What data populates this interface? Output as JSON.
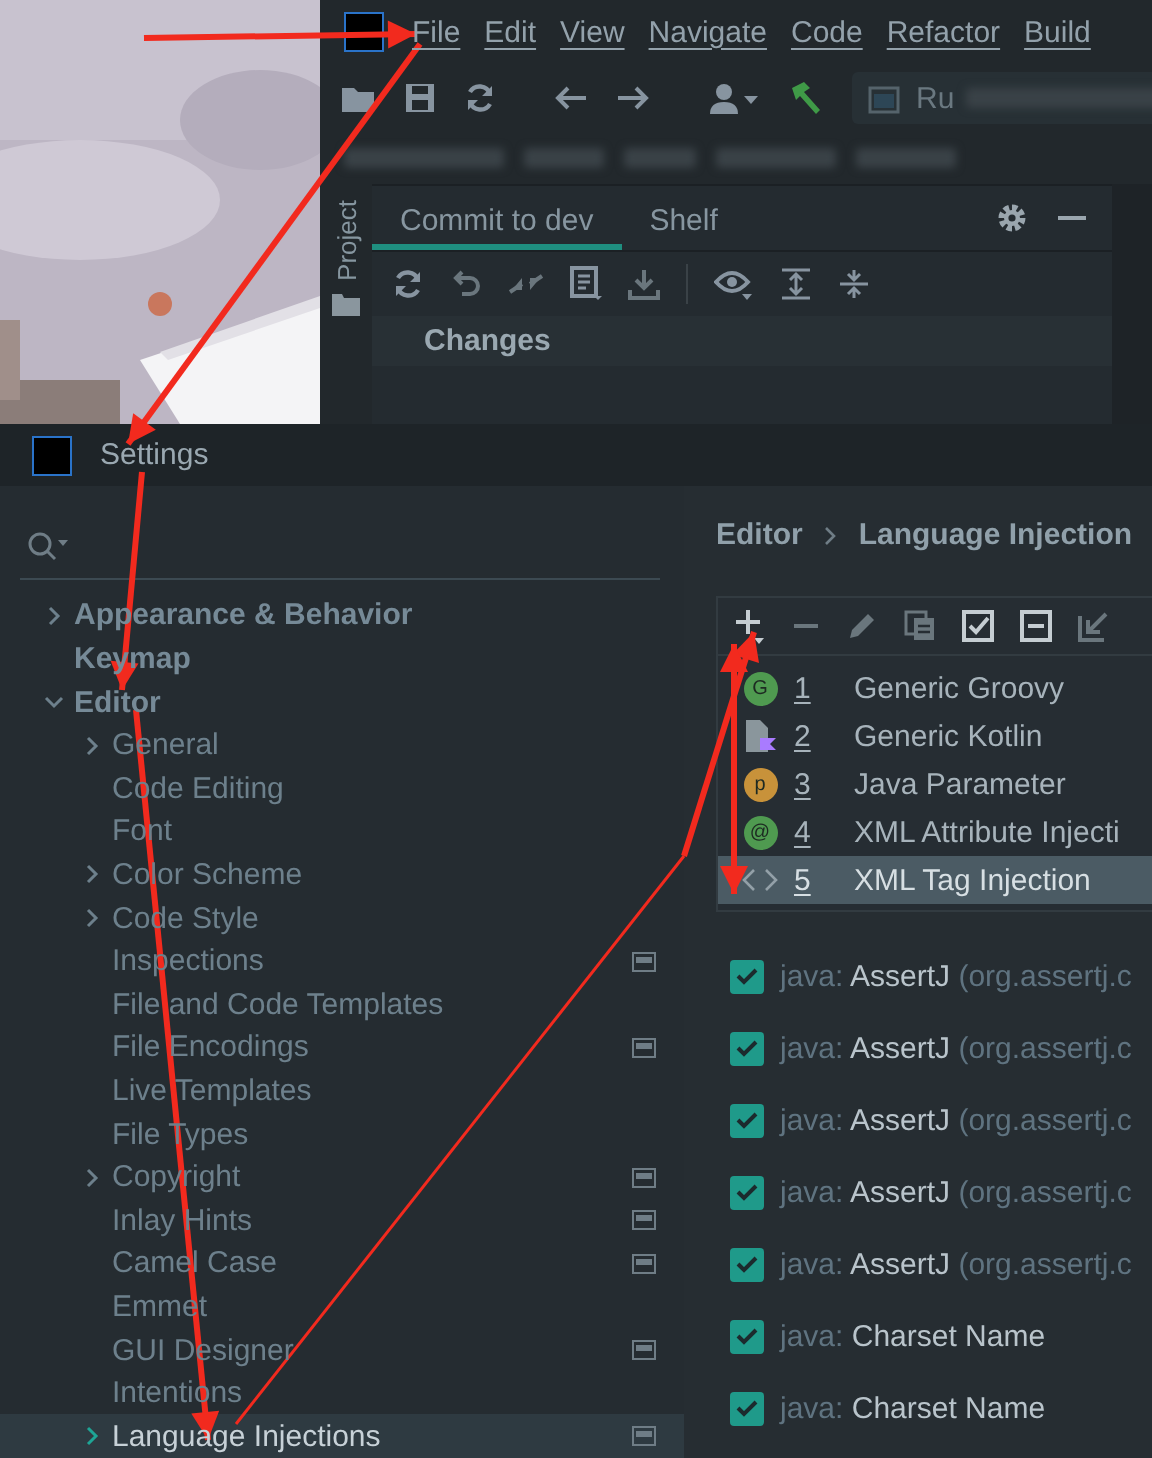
{
  "ide": {
    "menu": [
      "File",
      "Edit",
      "View",
      "Navigate",
      "Code",
      "Refactor",
      "Build"
    ],
    "run_config": "Ru",
    "side_tabs": [
      "Project"
    ],
    "commit_tabs": [
      {
        "label": "Commit to dev",
        "selected": true
      },
      {
        "label": "Shelf",
        "selected": false
      }
    ],
    "changes_header": "Changes"
  },
  "settings": {
    "title": "Settings",
    "tree": [
      {
        "label": "Appearance & Behavior",
        "kind": "folder",
        "expanded": false,
        "project_icon": false,
        "selected": false
      },
      {
        "label": "Keymap",
        "kind": "page",
        "project_icon": false,
        "selected": false
      },
      {
        "label": "Editor",
        "kind": "folder",
        "expanded": true,
        "project_icon": false,
        "selected": false,
        "children": [
          {
            "label": "General",
            "kind": "folder",
            "expanded": false,
            "project_icon": false,
            "selected": false
          },
          {
            "label": "Code Editing",
            "kind": "page",
            "project_icon": false,
            "selected": false
          },
          {
            "label": "Font",
            "kind": "page",
            "project_icon": false,
            "selected": false
          },
          {
            "label": "Color Scheme",
            "kind": "folder",
            "expanded": false,
            "project_icon": false,
            "selected": false
          },
          {
            "label": "Code Style",
            "kind": "folder",
            "expanded": false,
            "project_icon": false,
            "selected": false
          },
          {
            "label": "Inspections",
            "kind": "page",
            "project_icon": true,
            "selected": false
          },
          {
            "label": "File and Code Templates",
            "kind": "page",
            "project_icon": false,
            "selected": false
          },
          {
            "label": "File Encodings",
            "kind": "page",
            "project_icon": true,
            "selected": false
          },
          {
            "label": "Live Templates",
            "kind": "page",
            "project_icon": false,
            "selected": false
          },
          {
            "label": "File Types",
            "kind": "page",
            "project_icon": false,
            "selected": false
          },
          {
            "label": "Copyright",
            "kind": "folder",
            "expanded": false,
            "project_icon": true,
            "selected": false
          },
          {
            "label": "Inlay Hints",
            "kind": "page",
            "project_icon": true,
            "selected": false
          },
          {
            "label": "Camel Case",
            "kind": "page",
            "project_icon": true,
            "selected": false
          },
          {
            "label": "Emmet",
            "kind": "page",
            "project_icon": false,
            "selected": false
          },
          {
            "label": "GUI Designer",
            "kind": "page",
            "project_icon": true,
            "selected": false
          },
          {
            "label": "Intentions",
            "kind": "page",
            "project_icon": false,
            "selected": false
          },
          {
            "label": "Language Injections",
            "kind": "folder",
            "expanded": false,
            "project_icon": true,
            "selected": true
          }
        ]
      }
    ],
    "breadcrumb": [
      "Editor",
      "Language Injection"
    ],
    "injections": [
      {
        "kind": "circle",
        "badge": "G",
        "color": "#4f9a50",
        "index": "1",
        "name": "Generic Groovy",
        "selected": false
      },
      {
        "kind": "kotlin",
        "index": "2",
        "name": "Generic Kotlin",
        "selected": false
      },
      {
        "kind": "circle",
        "badge": "p",
        "color": "#c8923a",
        "index": "3",
        "name": "Java Parameter",
        "selected": false
      },
      {
        "kind": "circle",
        "badge": "@",
        "color": "#4f9a50",
        "index": "4",
        "name": "XML Attribute Injecti",
        "selected": false
      },
      {
        "kind": "tag",
        "index": "5",
        "name": "XML Tag Injection",
        "selected": true
      }
    ],
    "entries": [
      {
        "checked": true,
        "prefix": "java:",
        "name": "AssertJ",
        "detail": "(org.assertj.c"
      },
      {
        "checked": true,
        "prefix": "java:",
        "name": "AssertJ",
        "detail": "(org.assertj.c"
      },
      {
        "checked": true,
        "prefix": "java:",
        "name": "AssertJ",
        "detail": "(org.assertj.c"
      },
      {
        "checked": true,
        "prefix": "java:",
        "name": "AssertJ",
        "detail": "(org.assertj.c"
      },
      {
        "checked": true,
        "prefix": "java:",
        "name": "AssertJ",
        "detail": "(org.assertj.c"
      },
      {
        "checked": true,
        "prefix": "java:",
        "name": "Charset Name"
      },
      {
        "checked": true,
        "prefix": "java:",
        "name": "Charset Name"
      }
    ]
  }
}
